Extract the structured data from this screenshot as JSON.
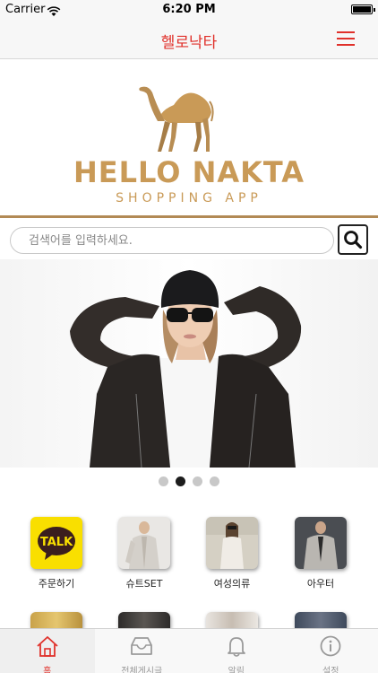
{
  "status_bar": {
    "carrier": "Carrier",
    "time": "6:20 PM"
  },
  "nav": {
    "title": "헬로낙타",
    "menu_icon": "hamburger-menu-icon"
  },
  "banner": {
    "brand_name": "HELLO NAKTA",
    "brand_subtitle": "SHOPPING APP",
    "logo_icon": "camel-icon"
  },
  "search": {
    "placeholder": "검색어를 입력하세요.",
    "value": ""
  },
  "carousel": {
    "page_count": 4,
    "active_page": 2
  },
  "categories": [
    {
      "label": "주문하기"
    },
    {
      "label": "슈트SET"
    },
    {
      "label": "여성의류"
    },
    {
      "label": "아우터"
    }
  ],
  "tabs": [
    {
      "label": "홈",
      "icon": "home-icon",
      "active": true
    },
    {
      "label": "전체게시글",
      "icon": "inbox-icon",
      "active": false
    },
    {
      "label": "알림",
      "icon": "bell-icon",
      "active": false
    },
    {
      "label": "설정",
      "icon": "info-icon",
      "active": false
    }
  ],
  "colors": {
    "accent": "#e0312b",
    "brand_gold": "#c99a57",
    "tab_inactive": "#9a9a9a"
  }
}
